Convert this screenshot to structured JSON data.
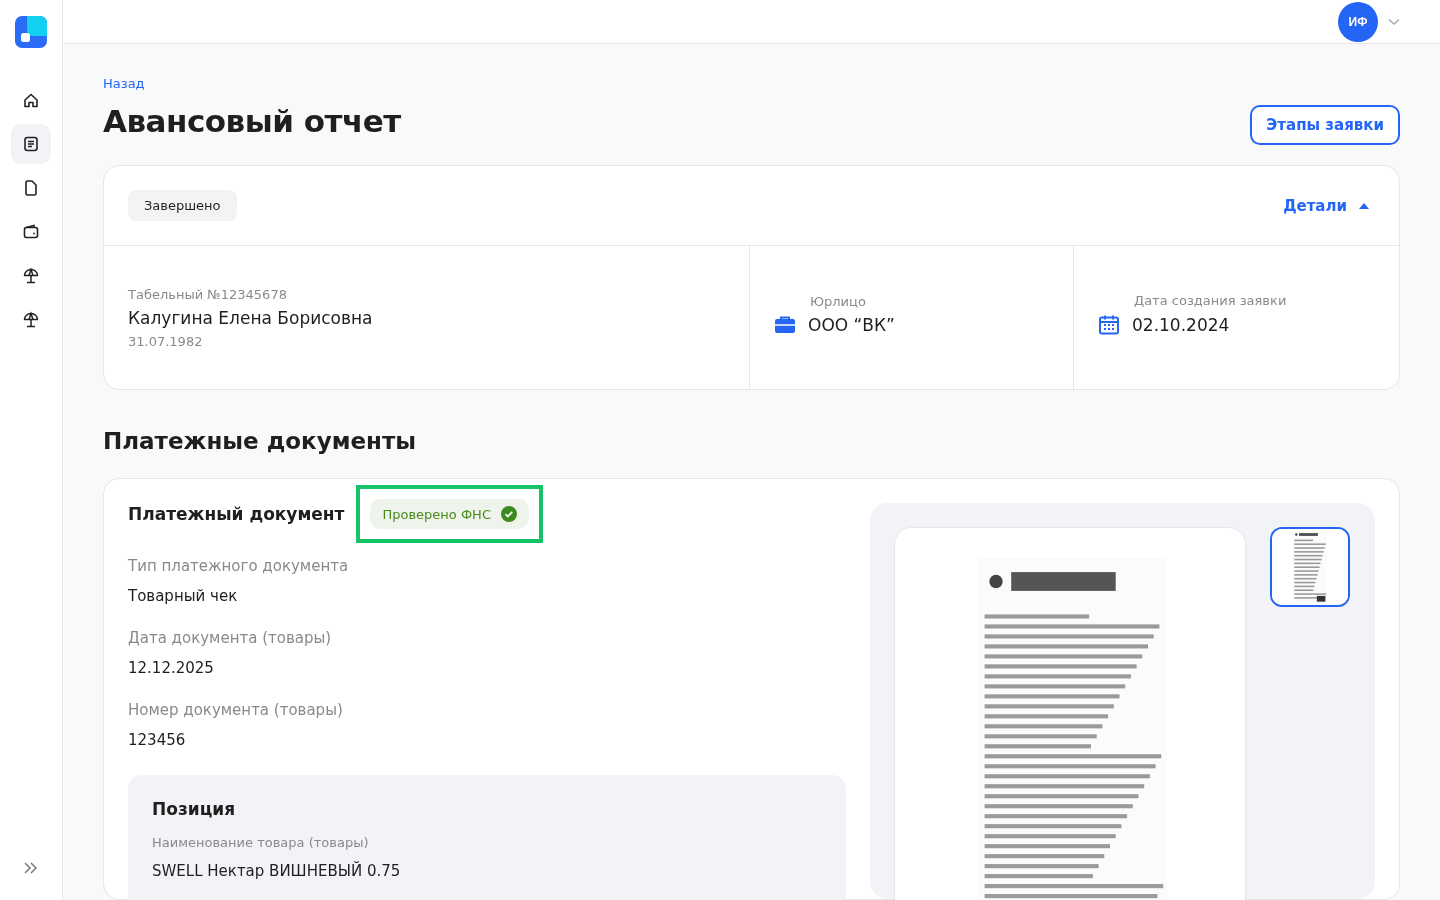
{
  "sidebar": {
    "items": [
      {
        "kind": "home",
        "selected": false
      },
      {
        "kind": "list",
        "selected": true
      },
      {
        "kind": "file",
        "selected": false
      },
      {
        "kind": "wallet",
        "selected": false
      },
      {
        "kind": "umbrella",
        "selected": false
      },
      {
        "kind": "umbrella",
        "selected": false
      }
    ]
  },
  "header": {
    "avatar": "ИФ"
  },
  "back_link": "Назад",
  "title": "Авансовый отчет",
  "stages_button": "Этапы заявки",
  "summary": {
    "status": "Завершено",
    "details_toggle": {
      "label": "Детали",
      "expanded": true
    },
    "employee": {
      "tab_number": "Табельный №12345678",
      "name": "Калугина Елена Борисовна",
      "birth_date": "31.07.1982"
    },
    "entity": {
      "label": "Юрлицо",
      "value": "ООО “ВК”"
    },
    "created": {
      "label": "Дата создания заявки",
      "value": "02.10.2024"
    }
  },
  "section_title": "Платежные документы",
  "document": {
    "title": "Платежный документ",
    "badge": {
      "label": "Проверено ФНС",
      "verified": true,
      "highlighted": true
    },
    "fields": [
      {
        "label": "Тип платежного документа",
        "value": "Товарный чек"
      },
      {
        "label": "Дата документа (товары)",
        "value": "12.12.2025"
      },
      {
        "label": "Номер документа (товары)",
        "value": "123456"
      }
    ],
    "position": {
      "title": "Позиция",
      "label": "Наименование товара (товары)",
      "value": "SWELL Нектар ВИШНЕВЫЙ 0.75"
    },
    "preview": {
      "kind": "picture",
      "thumbnails": [
        {
          "kind": "picture",
          "selected": true
        }
      ]
    }
  }
}
